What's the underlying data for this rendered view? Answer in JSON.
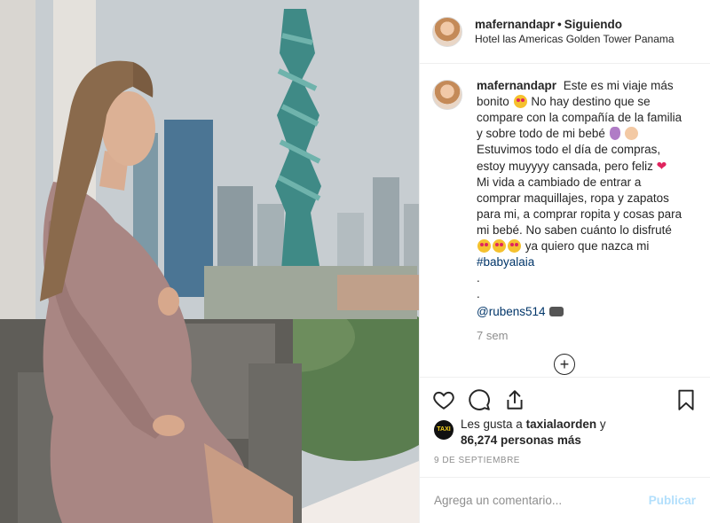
{
  "post": {
    "username": "mafernandapr",
    "separator": "•",
    "follow_status": "Siguiendo",
    "location": "Hotel las Americas Golden Tower Panama"
  },
  "caption": {
    "username": "mafernandapr",
    "part1": "Este es mi viaje más bonito",
    "part2": "No hay destino que se compare con la compañía de la familia y sobre todo de mi bebé",
    "part3": "Estuvimos todo el día de compras, estoy muyyyy cansada, pero feliz",
    "part4": "Mi vida a cambiado de entrar a comprar maquillajes, ropa y zapatos para mi, a comprar ropita y cosas para mi bebé. No saben cuánto lo disfruté",
    "part5": "ya quiero que nazca mi",
    "hashtag": "#babyalaia",
    "dot1": ".",
    "dot2": ".",
    "mention": "@rubens514",
    "time_ago": "7 sem"
  },
  "icons": {
    "like": "heart-outline-icon",
    "comment": "comment-bubble-icon",
    "share": "share-upload-icon",
    "save": "bookmark-icon",
    "load_more": "plus-circle-icon"
  },
  "load_more_symbol": "+",
  "likes": {
    "avatar_text": "TAXI",
    "prefix": "Les gusta a",
    "liker": "taxialaorden",
    "conjunction": "y",
    "count": "86,274 personas más"
  },
  "date": "9 DE SEPTIEMBRE",
  "comment_box": {
    "placeholder": "Agrega un comentario...",
    "publish_label": "Publicar"
  },
  "colors": {
    "link": "#003569",
    "muted": "#8e8e8e",
    "publish_disabled": "#b2dffc",
    "heart": "#e0245e"
  }
}
